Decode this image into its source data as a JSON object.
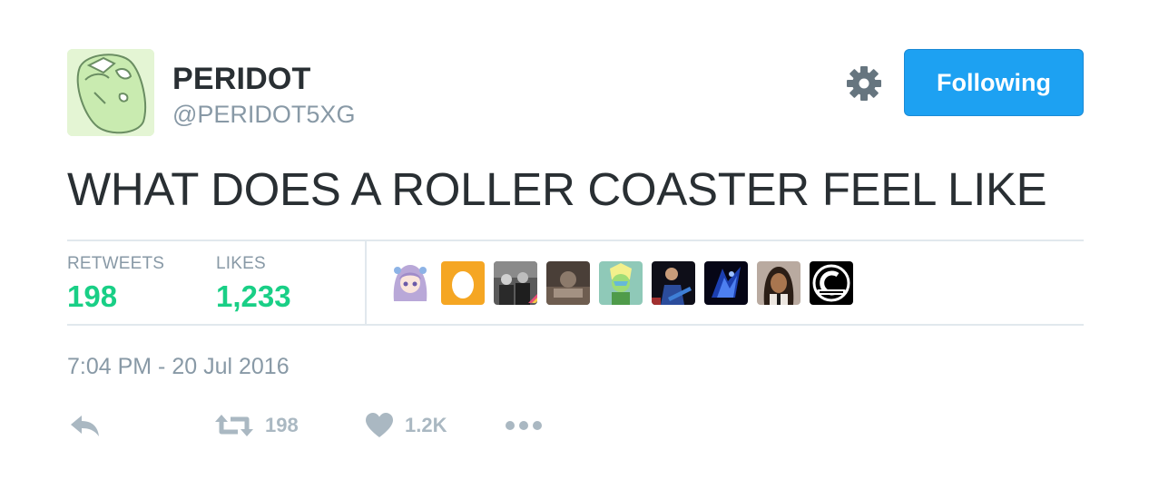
{
  "user": {
    "display_name": "PERIDOT",
    "screen_name": "@PERIDOT5XG",
    "avatar_icon": "peridot-avatar"
  },
  "header": {
    "settings_icon": "gear-icon",
    "follow_label": "Following",
    "follow_color": "#1da1f2"
  },
  "tweet": {
    "text": "WHAT DOES A ROLLER COASTER FEEL LIKE",
    "timestamp": "7:04 PM - 20 Jul 2016"
  },
  "stats": {
    "retweets_label": "RETWEETS",
    "retweets_value": "198",
    "likes_label": "LIKES",
    "likes_value": "1,233",
    "value_color": "#19cf86"
  },
  "liker_avatars": [
    "anime-girl-avatar",
    "egg-avatar",
    "group-photo-avatar",
    "photo-avatar",
    "peridot-avatar",
    "guitarist-avatar",
    "blue-art-avatar",
    "portrait-avatar",
    "capsule-corp-logo-avatar"
  ],
  "actions": {
    "reply_icon": "reply-icon",
    "retweet_icon": "retweet-icon",
    "retweet_count": "198",
    "like_icon": "heart-icon",
    "like_count": "1.2K",
    "more_icon": "more-dots-icon"
  }
}
